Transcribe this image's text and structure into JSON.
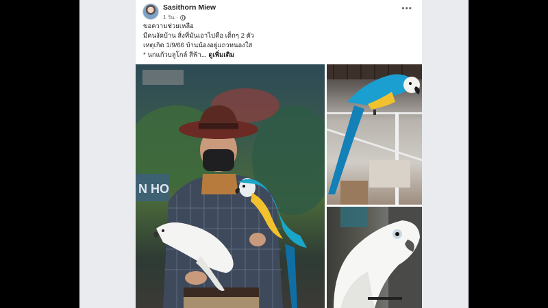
{
  "post": {
    "author": "Sasithorn Miew",
    "time": "1 วัน",
    "privacy_icon": "globe-icon",
    "more_icon": "more-options-icon",
    "lines": [
      "ขอความช่วยเหลือ",
      "มีคนงัดบ้าน สิ่งที่มันเอาไปคือ เด็กๆ 2 ตัว",
      "เหตุเกิด 1/9/66 บ้านน้องอยู่แถวหนองใส"
    ],
    "last_line_prefix": "* นกแก้วบลูโกล์ สีฟ้า... ",
    "see_more": "ดูเพิ่มเติม"
  },
  "photos": {
    "main_sign_text": "N HO"
  },
  "colors": {
    "page_background": "#e9ebee",
    "card_background": "#ffffff",
    "text_primary": "#1c1e21",
    "text_secondary": "#65676b"
  }
}
